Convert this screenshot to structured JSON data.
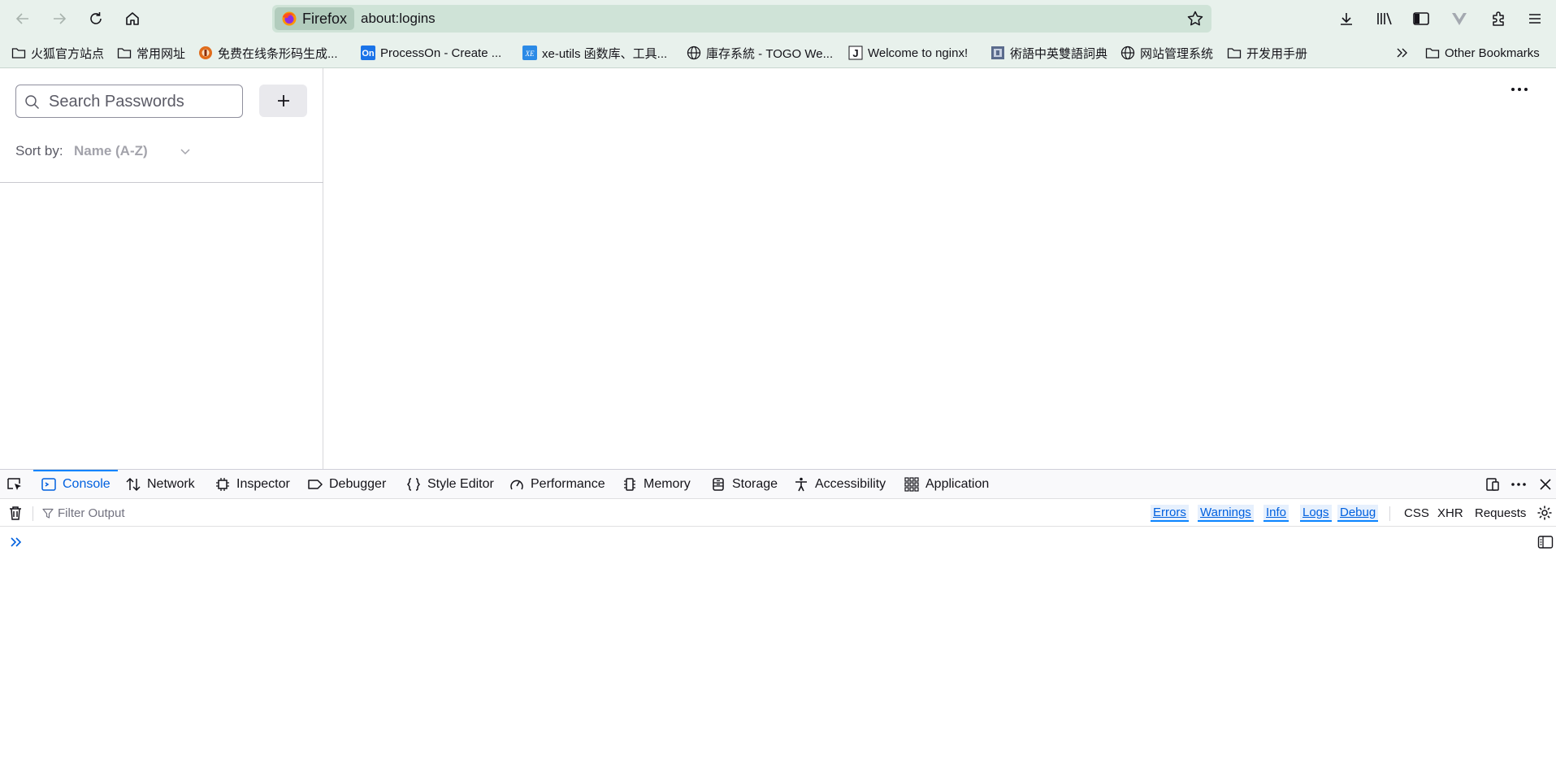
{
  "browser": {
    "identity_label": "Firefox",
    "url": "about:logins"
  },
  "bookmarks": [
    {
      "label": "火狐官方站点",
      "icon": "folder-icon"
    },
    {
      "label": "常用网址",
      "icon": "folder-icon"
    },
    {
      "label": "免费在线条形码生成...",
      "icon": "site-favicon"
    },
    {
      "label": "ProcessOn - Create ...",
      "icon": "processon-favicon"
    },
    {
      "label": "xe-utils 函数库、工具...",
      "icon": "xe-favicon"
    },
    {
      "label": "庫存系統 - TOGO We...",
      "icon": "globe-icon"
    },
    {
      "label": "Welcome to nginx!",
      "icon": "j-favicon"
    },
    {
      "label": "術語中英雙語詞典",
      "icon": "site-favicon"
    },
    {
      "label": "网站管理系统",
      "icon": "globe-icon"
    },
    {
      "label": "开发用手册",
      "icon": "folder-icon"
    }
  ],
  "bookmarks_other": "Other Bookmarks",
  "logins": {
    "search_placeholder": "Search Passwords",
    "add_label": "+",
    "sort_label": "Sort by:",
    "sort_value": "Name (A-Z)"
  },
  "devtools": {
    "tabs": [
      "Console",
      "Network",
      "Inspector",
      "Debugger",
      "Style Editor",
      "Performance",
      "Memory",
      "Storage",
      "Accessibility",
      "Application"
    ],
    "active_tab": "Console",
    "filter_placeholder": "Filter Output",
    "levels": [
      "Errors",
      "Warnings",
      "Info",
      "Logs",
      "Debug"
    ],
    "requests": [
      "CSS",
      "XHR",
      "Requests"
    ]
  },
  "colors": {
    "toolbar_bg": "#e8f1ec",
    "urlbar_bg": "#cfe3d7",
    "accent": "#0060df"
  }
}
